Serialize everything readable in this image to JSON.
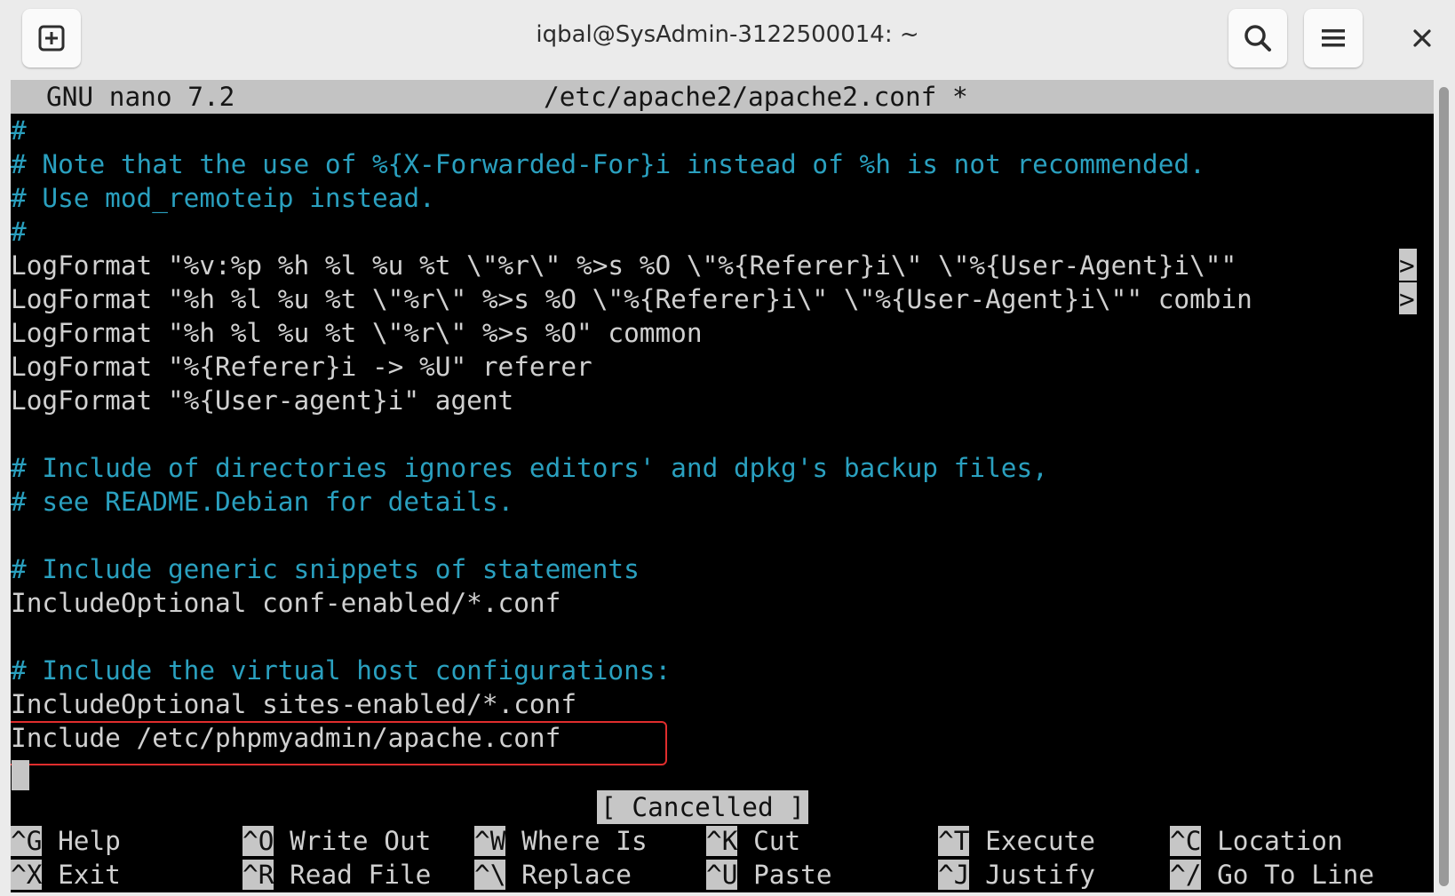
{
  "window": {
    "title": "iqbal@SysAdmin-3122500014: ~"
  },
  "icons": {
    "new_tab": "new-tab-icon",
    "search": "search-icon",
    "menu": "hamburger-menu-icon",
    "close": "close-icon"
  },
  "nano": {
    "version": "GNU nano 7.2",
    "filename": "/etc/apache2/apache2.conf *",
    "lines": [
      {
        "text": "#",
        "kind": "comment"
      },
      {
        "text": "# Note that the use of %{X-Forwarded-For}i instead of %h is not recommended.",
        "kind": "comment"
      },
      {
        "text": "# Use mod_remoteip instead.",
        "kind": "comment"
      },
      {
        "text": "#",
        "kind": "comment"
      },
      {
        "text": "LogFormat \"%v:%p %h %l %u %t \\\"%r\\\" %>s %O \\\"%{Referer}i\\\" \\\"%{User-Agent}i\\\"\" ",
        "kind": "text",
        "overflow": ">"
      },
      {
        "text": "LogFormat \"%h %l %u %t \\\"%r\\\" %>s %O \\\"%{Referer}i\\\" \\\"%{User-Agent}i\\\"\" combin",
        "kind": "text",
        "overflow": ">"
      },
      {
        "text": "LogFormat \"%h %l %u %t \\\"%r\\\" %>s %O\" common",
        "kind": "text"
      },
      {
        "text": "LogFormat \"%{Referer}i -> %U\" referer",
        "kind": "text"
      },
      {
        "text": "LogFormat \"%{User-agent}i\" agent",
        "kind": "text"
      },
      {
        "text": "",
        "kind": "text"
      },
      {
        "text": "# Include of directories ignores editors' and dpkg's backup files,",
        "kind": "comment"
      },
      {
        "text": "# see README.Debian for details.",
        "kind": "comment"
      },
      {
        "text": "",
        "kind": "text"
      },
      {
        "text": "# Include generic snippets of statements",
        "kind": "comment"
      },
      {
        "text": "IncludeOptional conf-enabled/*.conf",
        "kind": "text"
      },
      {
        "text": "",
        "kind": "text"
      },
      {
        "text": "# Include the virtual host configurations:",
        "kind": "comment"
      },
      {
        "text": "IncludeOptional sites-enabled/*.conf",
        "kind": "text"
      },
      {
        "text": "Include /etc/phpmyadmin/apache.conf",
        "kind": "text",
        "highlighted": true
      }
    ],
    "status": "[ Cancelled ]",
    "shortcuts_row1": [
      {
        "key": "^G",
        "label": "Help"
      },
      {
        "key": "^O",
        "label": "Write Out"
      },
      {
        "key": "^W",
        "label": "Where Is"
      },
      {
        "key": "^K",
        "label": "Cut"
      },
      {
        "key": "^T",
        "label": "Execute"
      },
      {
        "key": "^C",
        "label": "Location"
      }
    ],
    "shortcuts_row2": [
      {
        "key": "^X",
        "label": "Exit"
      },
      {
        "key": "^R",
        "label": "Read File"
      },
      {
        "key": "^\\",
        "label": "Replace"
      },
      {
        "key": "^U",
        "label": "Paste"
      },
      {
        "key": "^J",
        "label": "Justify"
      },
      {
        "key": "^/",
        "label": "Go To Line"
      }
    ]
  }
}
